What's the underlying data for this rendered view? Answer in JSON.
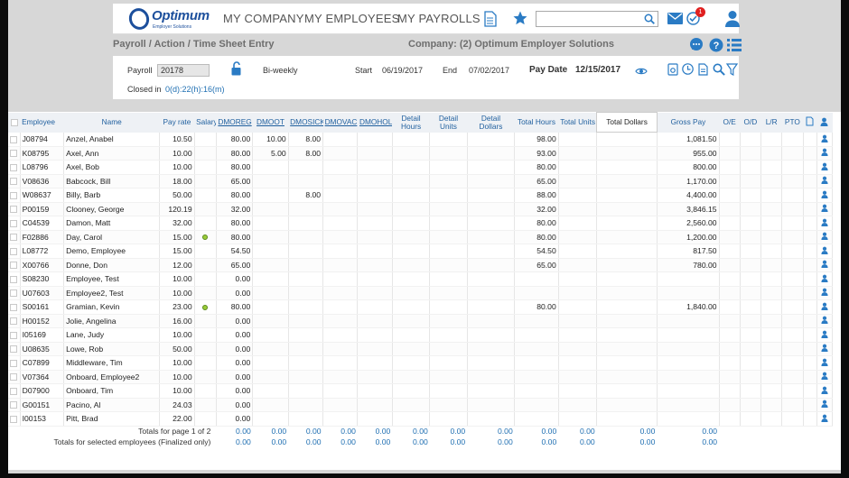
{
  "brand": {
    "name": "Optimum",
    "sub": "Employer Solutions"
  },
  "nav": {
    "company": "MY COMPANY",
    "employees": "MY EMPLOYEES",
    "payrolls": "MY PAYROLLS"
  },
  "search": {
    "value": "",
    "placeholder": ""
  },
  "notifications": {
    "count": "1"
  },
  "breadcrumb": "Payroll / Action / Time Sheet Entry",
  "company_label": "Company: (2) Optimum Employer Solutions",
  "payroll": {
    "label": "Payroll",
    "number": "20178",
    "frequency": "Bi-weekly",
    "start_label": "Start",
    "start": "06/19/2017",
    "end_label": "End",
    "end": "07/02/2017",
    "paydate_label": "Pay Date",
    "paydate": "12/15/2017",
    "closed_label": "Closed in",
    "closed": "0(d):22(h):16(m)"
  },
  "columns": {
    "employee": "Employee",
    "name": "Name",
    "payrate": "Pay rate",
    "salary": "Salary",
    "dmoreg": "DMOREG",
    "dmoot": "DMOOT",
    "dmosick": "DMOSICK",
    "dmovac": "DMOVAC",
    "dmohols": "DMOHOLS",
    "detail_hours": "Detail Hours",
    "detail_units": "Detail Units",
    "detail_dollars": "Detail Dollars",
    "total_hours": "Total Hours",
    "total_units": "Total Units",
    "total_dollars": "Total Dollars",
    "gross_pay": "Gross Pay",
    "oe": "O/E",
    "od": "O/D",
    "lr": "L/R",
    "pto": "PTO"
  },
  "rows": [
    {
      "id": "J08794",
      "name": "Anzel, Anabel",
      "rate": "10.50",
      "salary": false,
      "reg": "80.00",
      "ot": "10.00",
      "sick": "8.00",
      "th": "98.00",
      "gross": "1,081.50"
    },
    {
      "id": "K08795",
      "name": "Axel, Ann",
      "rate": "10.00",
      "salary": false,
      "reg": "80.00",
      "ot": "5.00",
      "sick": "8.00",
      "th": "93.00",
      "gross": "955.00"
    },
    {
      "id": "L08796",
      "name": "Axel, Bob",
      "rate": "10.00",
      "salary": false,
      "reg": "80.00",
      "ot": "",
      "sick": "",
      "th": "80.00",
      "gross": "800.00"
    },
    {
      "id": "V08636",
      "name": "Babcock, Bill",
      "rate": "18.00",
      "salary": false,
      "reg": "65.00",
      "ot": "",
      "sick": "",
      "th": "65.00",
      "gross": "1,170.00"
    },
    {
      "id": "W08637",
      "name": "Billy, Barb",
      "rate": "50.00",
      "salary": false,
      "reg": "80.00",
      "ot": "",
      "sick": "8.00",
      "th": "88.00",
      "gross": "4,400.00"
    },
    {
      "id": "P00159",
      "name": "Clooney, George",
      "rate": "120.19",
      "salary": false,
      "reg": "32.00",
      "ot": "",
      "sick": "",
      "th": "32.00",
      "gross": "3,846.15"
    },
    {
      "id": "C04539",
      "name": "Damon, Matt",
      "rate": "32.00",
      "salary": false,
      "reg": "80.00",
      "ot": "",
      "sick": "",
      "th": "80.00",
      "gross": "2,560.00"
    },
    {
      "id": "F02886",
      "name": "Day, Carol",
      "rate": "15.00",
      "salary": true,
      "reg": "80.00",
      "ot": "",
      "sick": "",
      "th": "80.00",
      "gross": "1,200.00"
    },
    {
      "id": "L08772",
      "name": "Demo, Employee",
      "rate": "15.00",
      "salary": false,
      "reg": "54.50",
      "ot": "",
      "sick": "",
      "th": "54.50",
      "gross": "817.50"
    },
    {
      "id": "X00766",
      "name": "Donne, Don",
      "rate": "12.00",
      "salary": false,
      "reg": "65.00",
      "ot": "",
      "sick": "",
      "th": "65.00",
      "gross": "780.00"
    },
    {
      "id": "S08230",
      "name": "Employee, Test",
      "rate": "10.00",
      "salary": false,
      "reg": "0.00",
      "ot": "",
      "sick": "",
      "th": "",
      "gross": ""
    },
    {
      "id": "U07603",
      "name": "Employee2, Test",
      "rate": "10.00",
      "salary": false,
      "reg": "0.00",
      "ot": "",
      "sick": "",
      "th": "",
      "gross": ""
    },
    {
      "id": "S00161",
      "name": "Gramian, Kevin",
      "rate": "23.00",
      "salary": true,
      "reg": "80.00",
      "ot": "",
      "sick": "",
      "th": "80.00",
      "gross": "1,840.00"
    },
    {
      "id": "H00152",
      "name": "Jolie, Angelina",
      "rate": "16.00",
      "salary": false,
      "reg": "0.00",
      "ot": "",
      "sick": "",
      "th": "",
      "gross": ""
    },
    {
      "id": "I05169",
      "name": "Lane, Judy",
      "rate": "10.00",
      "salary": false,
      "reg": "0.00",
      "ot": "",
      "sick": "",
      "th": "",
      "gross": ""
    },
    {
      "id": "U08635",
      "name": "Lowe, Rob",
      "rate": "50.00",
      "salary": false,
      "reg": "0.00",
      "ot": "",
      "sick": "",
      "th": "",
      "gross": ""
    },
    {
      "id": "C07899",
      "name": "Middleware, Tim",
      "rate": "10.00",
      "salary": false,
      "reg": "0.00",
      "ot": "",
      "sick": "",
      "th": "",
      "gross": ""
    },
    {
      "id": "V07364",
      "name": "Onboard, Employee2",
      "rate": "10.00",
      "salary": false,
      "reg": "0.00",
      "ot": "",
      "sick": "",
      "th": "",
      "gross": ""
    },
    {
      "id": "D07900",
      "name": "Onboard, Tim",
      "rate": "10.00",
      "salary": false,
      "reg": "0.00",
      "ot": "",
      "sick": "",
      "th": "",
      "gross": ""
    },
    {
      "id": "G00151",
      "name": "Pacino, Al",
      "rate": "24.03",
      "salary": false,
      "reg": "0.00",
      "ot": "",
      "sick": "",
      "th": "",
      "gross": ""
    },
    {
      "id": "I00153",
      "name": "Pitt, Brad",
      "rate": "22.00",
      "salary": false,
      "reg": "0.00",
      "ot": "",
      "sick": "",
      "th": "",
      "gross": ""
    }
  ],
  "totals": {
    "page_label": "Totals for page 1 of 2",
    "selected_label": "Totals for selected employees (Finalized only)",
    "zero": "0.00"
  },
  "colors": {
    "accent": "#1f5f9e",
    "brand": "#1c4f9c",
    "badge": "#e02020",
    "salary_dot": "#9bcc3a"
  }
}
